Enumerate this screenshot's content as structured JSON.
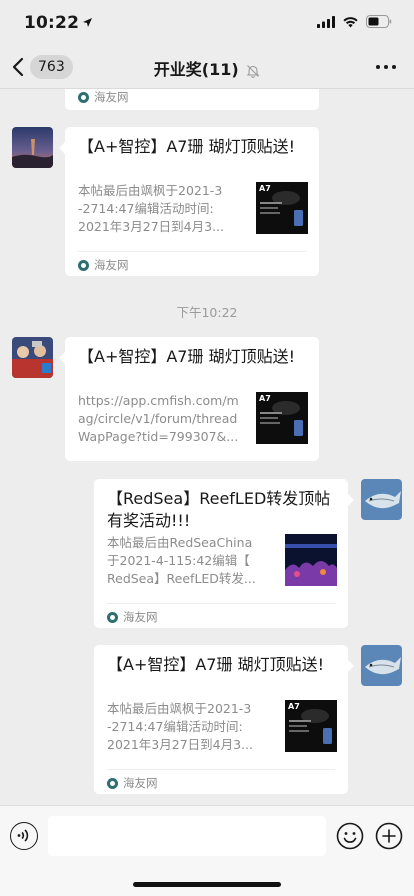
{
  "status_bar": {
    "time": "10:22"
  },
  "nav": {
    "back_count": "763",
    "title": "开业奖(11)"
  },
  "chat": {
    "timestamp": "下午10:22",
    "messages": [
      {
        "source": "海友网"
      },
      {
        "title": "【A+智控】A7珊 瑚灯顶贴送!",
        "desc": [
          "本帖最后由飒枫于2021-3",
          "-2714:47编辑活动时间:",
          "2021年3月27日到4月3..."
        ],
        "thumb_label": "A7",
        "source": "海友网"
      },
      {
        "title": "【A+智控】A7珊 瑚灯顶贴送!",
        "desc": [
          "https://app.cmfish.com/m",
          "ag/circle/v1/forum/thread",
          "WapPage?tid=799307&..."
        ],
        "thumb_label": "A7",
        "source": "海友网"
      },
      {
        "title": "【RedSea】ReefLED转发顶帖有奖活动!!!",
        "desc": [
          "本帖最后由RedSeaChina",
          "于2021-4-115:42编辑【",
          "RedSea】ReefLED转发..."
        ],
        "source": "海友网"
      },
      {
        "title": "【A+智控】A7珊 瑚灯顶贴送!",
        "desc": [
          "本帖最后由飒枫于2021-3",
          "-2714:47编辑活动时间:",
          "2021年3月27日到4月3..."
        ],
        "thumb_label": "A7",
        "source": "海友网"
      }
    ]
  },
  "colors": {
    "background": "#ededed",
    "bubble": "#ffffff",
    "secondary_text": "#8c8c8c",
    "source_logo": "#2e6e73"
  }
}
